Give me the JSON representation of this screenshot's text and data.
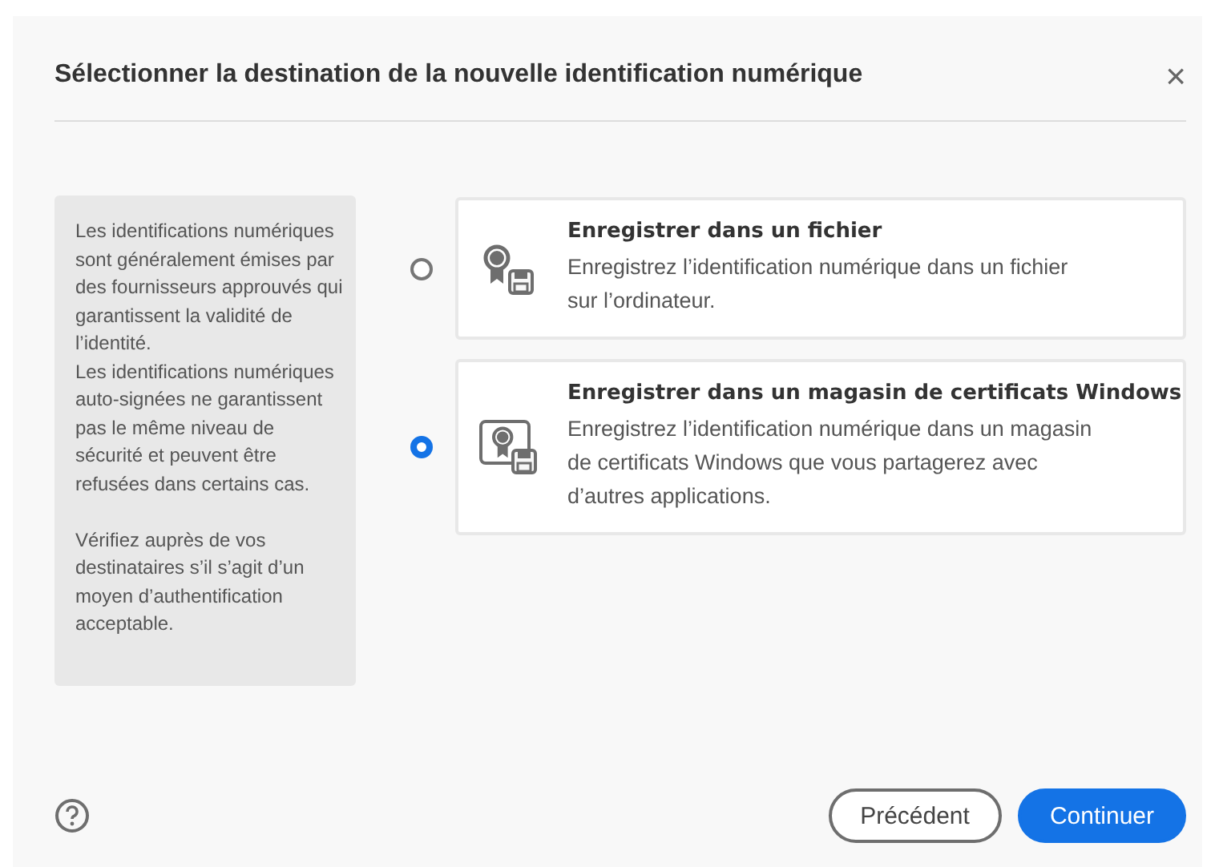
{
  "dialog": {
    "title": "Sélectionner la destination de la nouvelle identification numérique",
    "close": "×"
  },
  "info": "Les identifications numériques sont généralement émises par des fournisseurs approuvés qui garantissent la validité de l’identité.\nLes identifications numériques auto-signées ne garantissent pas le même niveau de sécurité et peuvent être refusées dans certains cas.\n\nVérifiez auprès de vos destinataires s’il s’agit d’un moyen d’authentification acceptable.",
  "options": [
    {
      "kind": "file",
      "title": "Enregistrer dans un fichier",
      "description": "Enregistrez l’identification numérique dans un fichier sur l’ordinateur.",
      "selected": false
    },
    {
      "kind": "store",
      "title": "Enregistrer dans un magasin de certificats Windows",
      "description": "Enregistrez l’identification numérique dans un magasin de certificats Windows que vous partagerez avec d’autres applications.",
      "selected": true
    }
  ],
  "buttons": [
    {
      "kind": "secondary",
      "label": "Précédent"
    },
    {
      "kind": "primary",
      "label": "Continuer"
    }
  ]
}
